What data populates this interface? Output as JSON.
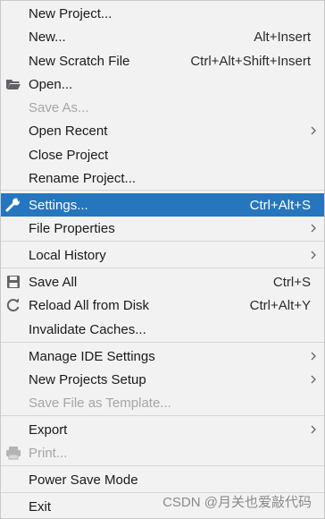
{
  "menu": {
    "items": [
      {
        "label": "New Project...",
        "shortcut": ""
      },
      {
        "label": "New...",
        "shortcut": "Alt+Insert"
      },
      {
        "label": "New Scratch File",
        "shortcut": "Ctrl+Alt+Shift+Insert"
      },
      {
        "label": "Open...",
        "shortcut": "",
        "icon": "folder-open-icon"
      },
      {
        "label": "Save As...",
        "shortcut": "",
        "disabled": true
      },
      {
        "label": "Open Recent",
        "shortcut": "",
        "submenu": true
      },
      {
        "label": "Close Project",
        "shortcut": ""
      },
      {
        "label": "Rename Project...",
        "shortcut": ""
      },
      {
        "label": "Settings...",
        "shortcut": "Ctrl+Alt+S",
        "icon": "wrench-icon",
        "selected": true
      },
      {
        "label": "File Properties",
        "shortcut": "",
        "submenu": true
      },
      {
        "label": "Local History",
        "shortcut": "",
        "submenu": true
      },
      {
        "label": "Save All",
        "shortcut": "Ctrl+S",
        "icon": "save-icon"
      },
      {
        "label": "Reload All from Disk",
        "shortcut": "Ctrl+Alt+Y",
        "icon": "reload-icon"
      },
      {
        "label": "Invalidate Caches...",
        "shortcut": ""
      },
      {
        "label": "Manage IDE Settings",
        "shortcut": "",
        "submenu": true
      },
      {
        "label": "New Projects Setup",
        "shortcut": "",
        "submenu": true
      },
      {
        "label": "Save File as Template...",
        "shortcut": "",
        "disabled": true
      },
      {
        "label": "Export",
        "shortcut": "",
        "submenu": true
      },
      {
        "label": "Print...",
        "shortcut": "",
        "icon": "printer-icon",
        "disabled": true
      },
      {
        "label": "Power Save Mode",
        "shortcut": ""
      },
      {
        "label": "Exit",
        "shortcut": ""
      }
    ]
  },
  "watermark": "CSDN @月关也爱敲代码",
  "colors": {
    "selection": "#2675bf",
    "background": "#f2f2f2",
    "disabled_text": "#a6a6a6"
  }
}
